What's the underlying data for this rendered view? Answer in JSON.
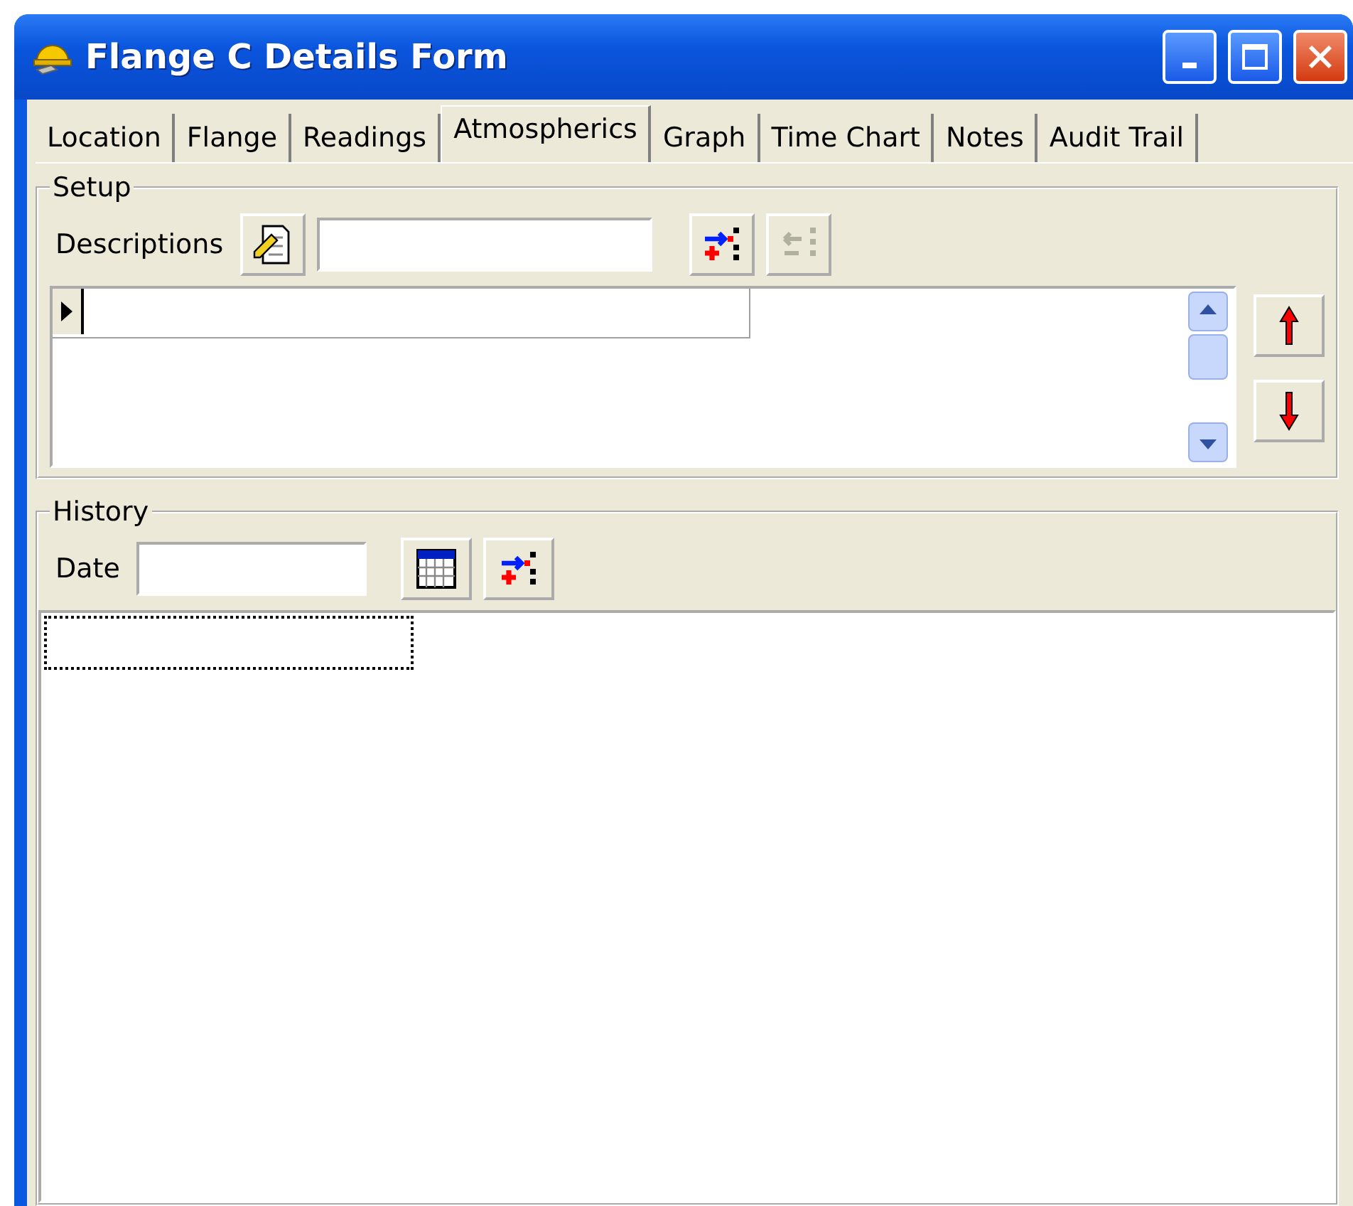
{
  "window": {
    "title": "Flange C Details Form"
  },
  "tabs": [
    {
      "label": "Location",
      "selected": false
    },
    {
      "label": "Flange",
      "selected": false
    },
    {
      "label": "Readings",
      "selected": false
    },
    {
      "label": "Atmospherics",
      "selected": true
    },
    {
      "label": "Graph",
      "selected": false
    },
    {
      "label": "Time Chart",
      "selected": false
    },
    {
      "label": "Notes",
      "selected": false
    },
    {
      "label": "Audit Trail",
      "selected": false
    }
  ],
  "setup": {
    "title": "Setup",
    "label": "Descriptions",
    "buttons": [
      {
        "kind": "add",
        "disabled": false
      },
      {
        "kind": "remove",
        "disabled": true
      }
    ]
  },
  "history": {
    "title": "History",
    "label": "Date"
  }
}
